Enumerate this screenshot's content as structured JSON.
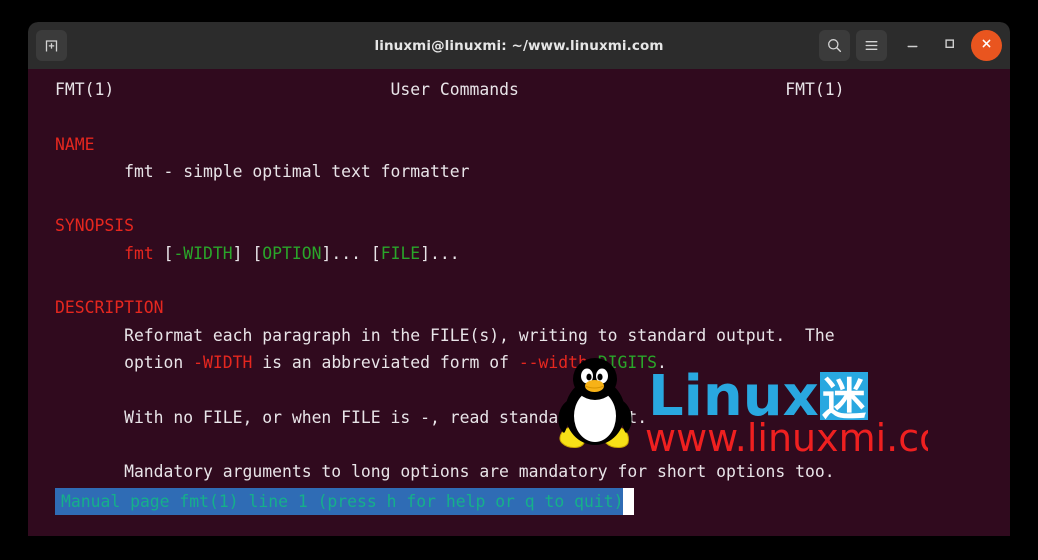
{
  "window": {
    "title": "linuxmi@linuxmi: ~/www.linuxmi.com",
    "new_tab_label": "New Tab",
    "search_label": "Find",
    "menu_label": "Menu",
    "minimize_label": "Minimize",
    "maximize_label": "Maximize",
    "close_label": "Close",
    "icons": {
      "new_tab": "new-tab-icon",
      "search": "search-icon",
      "menu": "hamburger-menu-icon",
      "minimize": "minimize-icon",
      "maximize": "maximize-icon",
      "close": "close-icon"
    },
    "colors": {
      "titlebar_bg": "#2c2c2c",
      "close_bg": "#e9551f",
      "terminal_bg": "#300a1e"
    }
  },
  "terminal": {
    "header": {
      "left": "FMT(1)",
      "center": "User Commands",
      "right": "FMT(1)"
    },
    "sections": {
      "name": {
        "heading": "NAME",
        "body": "       fmt - simple optimal text formatter"
      },
      "synopsis": {
        "heading": "SYNOPSIS",
        "indent": "       ",
        "cmd": "fmt",
        "part1": " [",
        "width": "-WIDTH",
        "part2": "] [",
        "option": "OPTION",
        "part3": "]... [",
        "file": "FILE",
        "part4": "]..."
      },
      "description": {
        "heading": "DESCRIPTION",
        "line1": "       Reformat each paragraph in the FILE(s), writing to standard output.  The",
        "line2_pre": "       option ",
        "line2_width": "-WIDTH",
        "line2_mid": " is an abbreviated form of ",
        "line2_longopt": "--width",
        "line2_eq": "=",
        "line2_digits": "DIGITS",
        "line2_end": ".",
        "line3": "       With no FILE, or when FILE is -, read standard input.",
        "line4": "       Mandatory arguments to long options are mandatory for short options too."
      }
    },
    "colors": {
      "heading": "#e5271f",
      "arg": "#2aa52a",
      "text": "#e8e4e8"
    }
  },
  "statusbar": {
    "text": "Manual page fmt(1) line 1 (press h for help or q to quit)",
    "bg": "#2f6cb5",
    "fg": "#15b08a"
  },
  "watermark": {
    "brand_latin": "Linux",
    "brand_cjk": "迷",
    "url": "www.linuxmi.com",
    "mascot": "tux-penguin-icon",
    "brand_color": "#29a8e0",
    "url_color": "#ef2020"
  }
}
